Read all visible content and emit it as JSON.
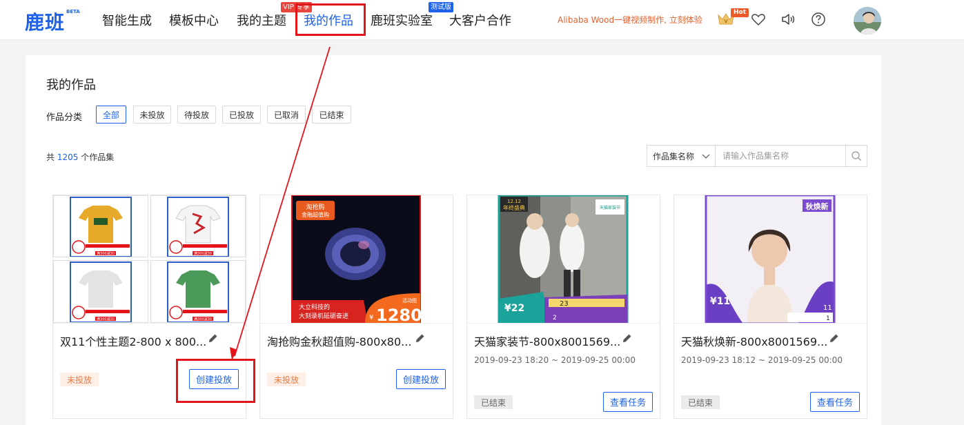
{
  "colors": {
    "brand": "#1d62e8",
    "highlight": "#e3141a",
    "promo": "#e8602c",
    "pending": "#ea7c43"
  },
  "header": {
    "logo": "鹿班",
    "logo_badge": "BETA",
    "nav": [
      {
        "label": "智能生成"
      },
      {
        "label": "模板中心"
      },
      {
        "label": "我的主题",
        "badge": "VIP 专享"
      },
      {
        "label": "我的作品",
        "active": true
      },
      {
        "label": "鹿班实验室",
        "badge": "测试版"
      },
      {
        "label": "大客户合作"
      }
    ],
    "promo": "Alibaba Wood一键视频制作, 立刻体验",
    "hot_badge": "Hot",
    "icons": [
      "crown-icon",
      "heart-icon",
      "speaker-icon",
      "help-icon"
    ]
  },
  "page": {
    "title": "我的作品",
    "category_label": "作品分类",
    "filters": [
      "全部",
      "未投放",
      "待投放",
      "已投放",
      "已取消",
      "已结束"
    ],
    "active_filter": "全部",
    "count_prefix": "共",
    "count": "1205",
    "count_suffix": "个作品集",
    "search_field": "作品集名称",
    "search_placeholder": "请输入作品集名称"
  },
  "cards": [
    {
      "title": "双11个性主题2-800 x 800...",
      "date": "",
      "status": "未投放",
      "action": "创建投放",
      "thumb_texts": [
        "满300减30",
        "满300减30",
        "满300减30",
        "满300减30"
      ]
    },
    {
      "title": "淘抢购金秋超值购-800x80...",
      "date": "",
      "status": "未投放",
      "action": "创建投放",
      "thumb_texts": [
        "淘抢购",
        "金融超值购",
        "大立科技的",
        "大刻录机砥砺奋进",
        "活动图",
        "¥",
        "1280"
      ]
    },
    {
      "title": "天猫家装节-800x8001569...",
      "date": "2019-09-23 18:20 ~ 2019-09-25 00:00",
      "status": "已结束",
      "action": "查看任务",
      "thumb_texts": [
        "12.12",
        "年终盛典",
        "天猫家装节",
        "¥22",
        "23",
        "2"
      ]
    },
    {
      "title": "天猫秋焕新-800x8001569...",
      "date": "2019-09-23 18:12 ~ 2019-09-25 00:00",
      "status": "已结束",
      "action": "查看任务",
      "thumb_texts": [
        "秋焕新",
        "¥11",
        "11",
        "1"
      ]
    }
  ]
}
